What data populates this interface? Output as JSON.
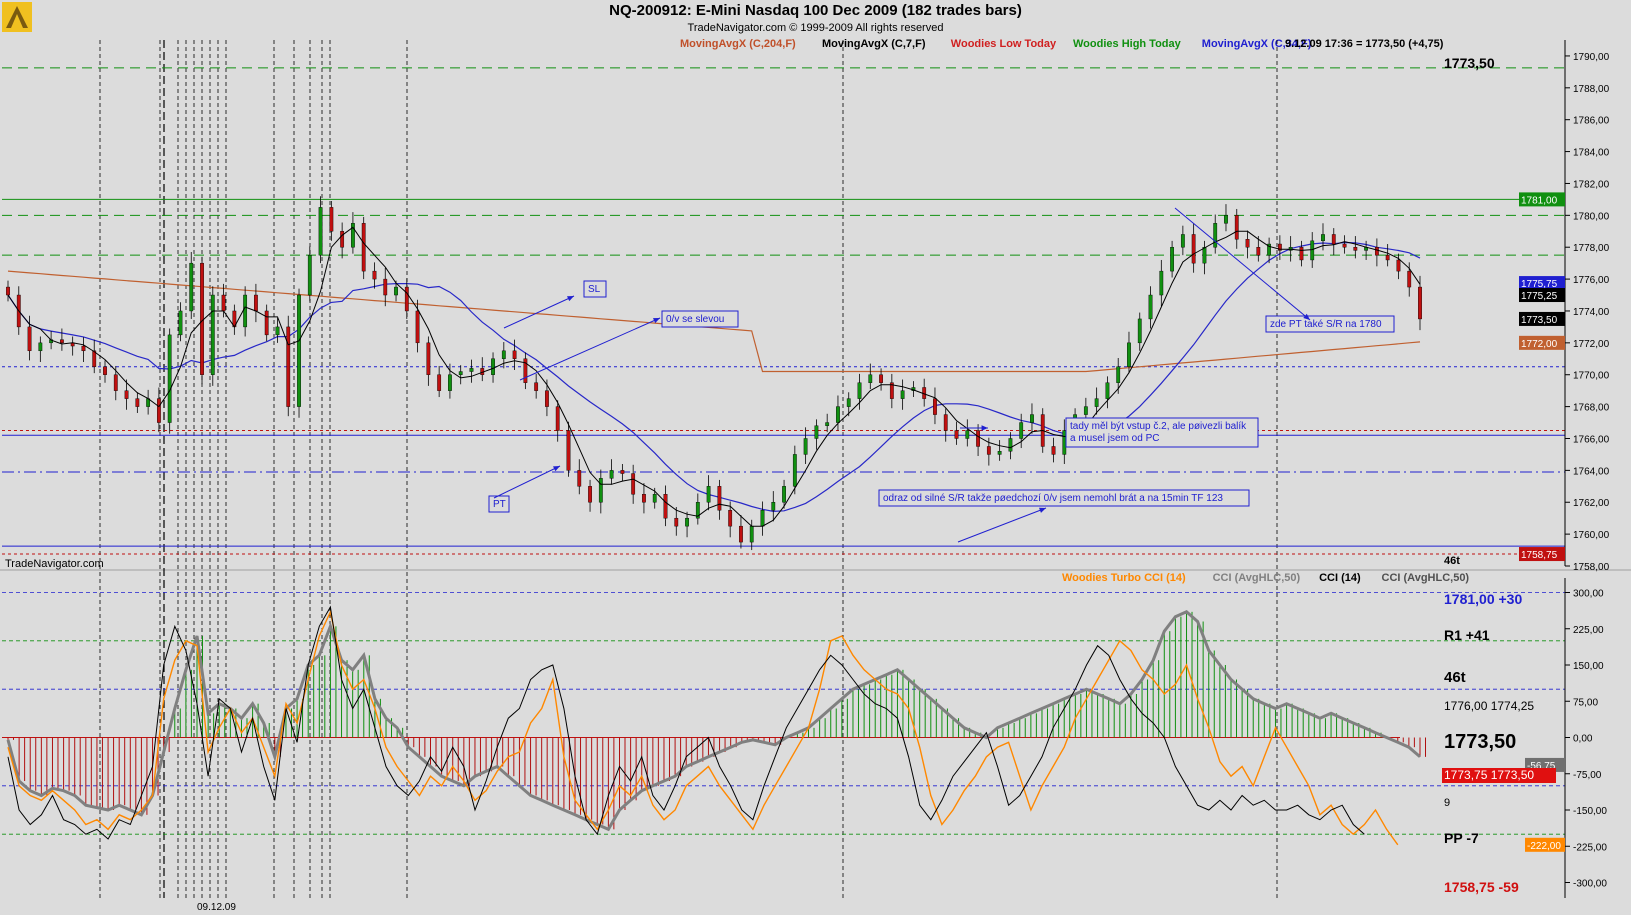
{
  "header": {
    "title": "NQ-200912:  E-Mini Nasdaq 100 Dec 2009  (182 trades bars)",
    "copyright": "TradeNavigator.com © 1999-2009 All rights reserved",
    "legend": [
      {
        "label": "MovingAvgX (C,204,F)",
        "color": "#c0502a"
      },
      {
        "label": "MovingAvgX (C,7,F)",
        "color": "#000000"
      },
      {
        "label": "Woodies Low Today",
        "color": "#d02020"
      },
      {
        "label": "Woodies High Today",
        "color": "#109010"
      },
      {
        "label": "MovingAvgX (C,34,F)",
        "color": "#2020d0"
      }
    ],
    "quote": "9.12.09 17:36 = 1773,50 (+4,75)"
  },
  "watermark": "TradeNavigator.com",
  "date_label": "09.12.09",
  "colors": {
    "up": "#109010",
    "down": "#c01010",
    "ma7": "#000000",
    "ma34": "#2828c8",
    "ma204": "#c06030",
    "cci": "#000000",
    "turbo": "#ff8800",
    "cciAvg": "#808080"
  },
  "price_labels": {
    "top_right": "1773,50",
    "tick_46t": "46t",
    "badges": [
      {
        "text": "1781,00",
        "price": 1781.0,
        "bg": "#109010",
        "fg": "#ffffff"
      },
      {
        "text": "1775,75",
        "price": 1775.75,
        "bg": "#2020d0",
        "fg": "#ffffff"
      },
      {
        "text": "1775,25",
        "price": 1775.0,
        "bg": "#000000",
        "fg": "#ffffff"
      },
      {
        "text": "1773,50",
        "price": 1773.5,
        "bg": "#000000",
        "fg": "#ffffff"
      },
      {
        "text": "1772,00",
        "price": 1772.0,
        "bg": "#c06030",
        "fg": "#ffffff"
      },
      {
        "text": "1758,75",
        "price": 1758.75,
        "bg": "#c01010",
        "fg": "#ffffff"
      }
    ]
  },
  "annotations": [
    {
      "text": "SL"
    },
    {
      "text": "0/v se slevou"
    },
    {
      "text": "PT"
    },
    {
      "text": "zde PT také S/R  na 1780"
    },
    {
      "text": "tady měl být vstup č.2, ale pøivezli balík"
    },
    {
      "text": "a musel jsem od PC"
    },
    {
      "text": "odraz od silné S/R takže pøedchozí 0/v jsem nemohl brát a na 15min TF 123"
    }
  ],
  "cci_panel": {
    "legend": [
      {
        "label": "Woodies Turbo CCI (14)",
        "color": "#ff8800"
      },
      {
        "label": "CCI (AvgHLC,50)",
        "color": "#808080"
      },
      {
        "label": "CCI (14)",
        "color": "#000000"
      },
      {
        "label": "CCI (AvgHLC,50)",
        "color": "#505050"
      }
    ],
    "side_text": [
      {
        "text": "1781,00 +30",
        "color": "#2020d0",
        "bold": true
      },
      {
        "text": "R1 +41",
        "color": "#000000",
        "bold": true
      },
      {
        "text": "46t",
        "color": "#000000",
        "bold": true
      },
      {
        "text": "1776,00  1774,25",
        "color": "#000000",
        "bold": false
      },
      {
        "text": "1773,50",
        "color": "#000000",
        "bold": true
      },
      {
        "text": "1773,75  1773,50",
        "color": "#ffffff",
        "bold": false
      },
      {
        "text": "9",
        "color": "#000000",
        "bold": false
      },
      {
        "text": "PP -7",
        "color": "#000000",
        "bold": true
      },
      {
        "text": "1758,75 -59",
        "color": "#d01010",
        "bold": true
      }
    ],
    "badges": [
      {
        "text": "-56,75",
        "value": -56.75,
        "bg": "#707070"
      },
      {
        "text": "-222,00",
        "value": -222,
        "bg": "#ff8800"
      }
    ]
  },
  "chart_data": [
    {
      "type": "candlestick",
      "title": "NQ-200912:  E-Mini Nasdaq 100 Dec 2009  (182 trades bars)",
      "ylim": [
        1758,
        1791
      ],
      "y_ticks": [
        "1790,00",
        "1788,00",
        "1786,00",
        "1784,00",
        "1782,00",
        "1780,00",
        "1778,00",
        "1776,00",
        "1774,00",
        "1772,00",
        "1770,00",
        "1768,00",
        "1766,00",
        "1764,00",
        "1762,00",
        "1760,00",
        "1758,00"
      ],
      "y_tick_values": [
        1790,
        1788,
        1786,
        1784,
        1782,
        1780,
        1778,
        1776,
        1774,
        1772,
        1770,
        1768,
        1766,
        1764,
        1762,
        1760,
        1758
      ],
      "close_path": [
        1775,
        1773,
        1771.5,
        1772,
        1772.2,
        1772,
        1771.8,
        1771.5,
        1770.5,
        1770,
        1769,
        1768.5,
        1768,
        1768.5,
        1767,
        1772.5,
        1774,
        1777,
        1770,
        1775,
        1774,
        1773,
        1775,
        1774,
        1772.5,
        1773,
        1768,
        1775,
        1777.5,
        1780.5,
        1779,
        1778,
        1779.5,
        1776.5,
        1776,
        1775,
        1775.5,
        1774,
        1772,
        1770,
        1769,
        1770,
        1770.2,
        1770.4,
        1770,
        1771,
        1771.5,
        1771,
        1769.5,
        1769,
        1768,
        1766.5,
        1764,
        1763,
        1762,
        1763.5,
        1764,
        1763.8,
        1762.5,
        1762,
        1762.5,
        1761,
        1760.5,
        1761,
        1762,
        1763,
        1761.5,
        1760.5,
        1759.5,
        1760.5,
        1761.5,
        1762,
        1763,
        1765,
        1766,
        1766.8,
        1767,
        1768,
        1768.5,
        1769.5,
        1770,
        1769.5,
        1768.5,
        1769,
        1769.2,
        1768.5,
        1767.5,
        1766.5,
        1766,
        1766.5,
        1765.5,
        1765,
        1765.2,
        1766,
        1767,
        1767.5,
        1765.5,
        1765,
        1766.5,
        1767.5,
        1768,
        1768.5,
        1769.5,
        1770.5,
        1772,
        1773.5,
        1775,
        1776.5,
        1778,
        1778.8,
        1777,
        1778,
        1779.5,
        1780,
        1778.5,
        1778,
        1777.5,
        1778.2,
        1777.8,
        1778,
        1777.2,
        1778.4,
        1778.8,
        1778.2,
        1778,
        1777.8,
        1778,
        1777.5,
        1777.2,
        1776.5,
        1775.5,
        1773.5
      ],
      "key_levels": [
        {
          "price": 1789.25,
          "color": "#109010",
          "style": "dash"
        },
        {
          "price": 1781.0,
          "color": "#109010",
          "style": "solid"
        },
        {
          "price": 1780.0,
          "color": "#109010",
          "style": "dash"
        },
        {
          "price": 1777.5,
          "color": "#109010",
          "style": "dash"
        },
        {
          "price": 1770.5,
          "color": "#2020d0",
          "style": "dot"
        },
        {
          "price": 1766.5,
          "color": "#c01010",
          "style": "dot"
        },
        {
          "price": 1766.2,
          "color": "#2020d0",
          "style": "solid"
        },
        {
          "price": 1763.9,
          "color": "#2020d0",
          "style": "dashdot"
        },
        {
          "price": 1759.25,
          "color": "#2020d0",
          "style": "solid"
        },
        {
          "price": 1758.75,
          "color": "#c01010",
          "style": "dot"
        }
      ]
    },
    {
      "type": "line",
      "title": "Woodies Turbo CCI (14)",
      "ylim": [
        -330,
        330
      ],
      "y_ticks": [
        "300,00",
        "225,00",
        "150,00",
        "75,00",
        "0,00",
        "-75,00",
        "-150,00",
        "-225,00",
        "-300,00"
      ],
      "y_tick_values": [
        300,
        225,
        150,
        75,
        0,
        -75,
        -150,
        -225,
        -300
      ],
      "zero_lines": [
        {
          "value": 300,
          "color": "#2020d0"
        },
        {
          "value": 200,
          "color": "#109010"
        },
        {
          "value": 100,
          "color": "#2020d0"
        },
        {
          "value": -100,
          "color": "#2020d0"
        },
        {
          "value": -200,
          "color": "#109010"
        }
      ],
      "series": [
        {
          "key": "cciAvg",
          "values": [
            -5,
            -90,
            -110,
            -120,
            -105,
            -110,
            -120,
            -140,
            -145,
            -150,
            -140,
            -150,
            -160,
            -120,
            -30,
            60,
            140,
            210,
            50,
            70,
            60,
            40,
            70,
            30,
            -40,
            60,
            80,
            150,
            170,
            230,
            160,
            140,
            170,
            80,
            40,
            20,
            -20,
            -40,
            -60,
            -80,
            -90,
            -100,
            -80,
            -70,
            -60,
            -80,
            -100,
            -120,
            -130,
            -140,
            -150,
            -160,
            -170,
            -180,
            -190,
            -150,
            -130,
            -110,
            -100,
            -90,
            -80,
            -60,
            -50,
            -40,
            -30,
            -20,
            -10,
            -5,
            -10,
            -15,
            0,
            10,
            20,
            40,
            60,
            80,
            100,
            110,
            120,
            130,
            140,
            120,
            100,
            80,
            60,
            40,
            20,
            10,
            0,
            20,
            30,
            40,
            50,
            60,
            70,
            80,
            90,
            100,
            90,
            80,
            70,
            90,
            120,
            160,
            220,
            250,
            260,
            240,
            180,
            150,
            120,
            100,
            80,
            70,
            60,
            70,
            60,
            50,
            40,
            50,
            40,
            30,
            20,
            10,
            0,
            -10,
            -20,
            -40
          ]
        },
        {
          "key": "turbo",
          "values": [
            -20,
            -100,
            -120,
            -130,
            -110,
            -130,
            -150,
            -180,
            -170,
            -190,
            -160,
            -170,
            -150,
            -120,
            80,
            160,
            200,
            190,
            -30,
            20,
            60,
            10,
            40,
            -20,
            -80,
            70,
            30,
            120,
            210,
            260,
            150,
            100,
            120,
            60,
            -20,
            -60,
            -90,
            -120,
            -80,
            -100,
            -60,
            -90,
            -130,
            -110,
            -70,
            -40,
            -30,
            30,
            60,
            120,
            -40,
            -130,
            -160,
            -190,
            -150,
            -100,
            -120,
            -80,
            -140,
            -170,
            -150,
            -100,
            -80,
            -60,
            -100,
            -130,
            -160,
            -190,
            -140,
            -100,
            -60,
            -20,
            20,
            100,
            200,
            210,
            170,
            140,
            120,
            100,
            90,
            60,
            -20,
            -120,
            -180,
            -150,
            -110,
            -80,
            -40,
            -20,
            -10,
            -80,
            -150,
            -100,
            -60,
            -20,
            40,
            80,
            120,
            160,
            200,
            180,
            140,
            120,
            90,
            110,
            150,
            80,
            20,
            -50,
            -80,
            -60,
            -100,
            -40,
            20,
            -20,
            -60,
            -100,
            -160,
            -140,
            -180,
            -200,
            -180,
            -150,
            -190,
            -222
          ]
        },
        {
          "key": "cci",
          "values": [
            -40,
            -150,
            -180,
            -160,
            -120,
            -170,
            -180,
            -200,
            -190,
            -210,
            -170,
            -180,
            -120,
            -60,
            150,
            230,
            180,
            70,
            -80,
            80,
            60,
            -30,
            40,
            -60,
            -130,
            60,
            -10,
            150,
            230,
            270,
            120,
            60,
            100,
            20,
            -60,
            -100,
            -120,
            -90,
            -40,
            -70,
            -20,
            -60,
            -150,
            -90,
            -20,
            40,
            60,
            120,
            140,
            150,
            60,
            -80,
            -170,
            -200,
            -120,
            -60,
            -90,
            -40,
            -120,
            -150,
            -100,
            -40,
            -20,
            0,
            -60,
            -100,
            -150,
            -170,
            -100,
            -40,
            20,
            60,
            100,
            140,
            170,
            150,
            120,
            90,
            70,
            60,
            40,
            -40,
            -140,
            -170,
            -130,
            -80,
            -50,
            -20,
            10,
            -60,
            -140,
            -120,
            -80,
            -40,
            20,
            60,
            100,
            150,
            190,
            170,
            120,
            80,
            50,
            30,
            0,
            -60,
            -100,
            -140,
            -150,
            -130,
            -150,
            -120,
            -140,
            -130,
            -150,
            -150,
            -140,
            -160,
            -170,
            -150,
            -140,
            -180,
            -200
          ]
        }
      ]
    }
  ]
}
